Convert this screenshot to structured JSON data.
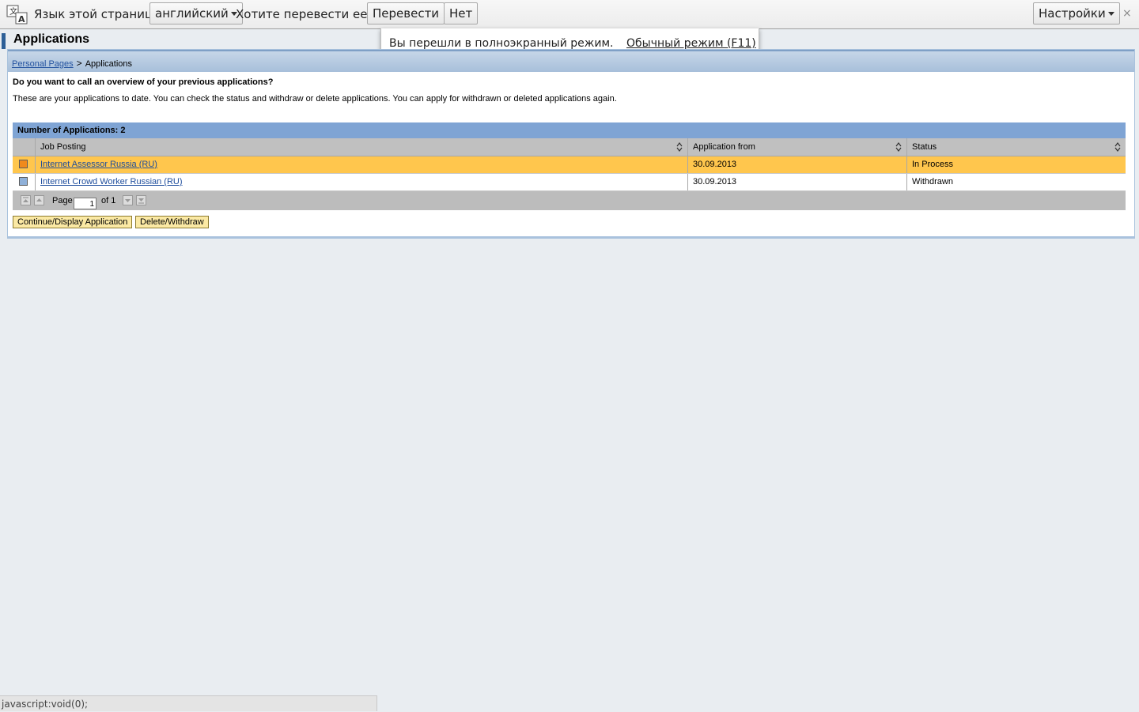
{
  "translate_bar": {
    "language_prompt": "Язык этой страницы",
    "language_value": "английский",
    "question": "Хотите перевести ее?",
    "translate_button": "Перевести",
    "no_button": "Нет",
    "settings_button": "Настройки",
    "close_glyph": "×"
  },
  "fullscreen_notice": {
    "message": "Вы перешли в полноэкранный режим.",
    "exit_link": "Обычный режим (F11)"
  },
  "page": {
    "title": "Applications",
    "breadcrumb": {
      "parent": "Personal Pages",
      "separator": ">",
      "current": "Applications"
    },
    "question": "Do you want to call an overview of your previous applications?",
    "description": "These are your applications to date. You can check the status and withdraw or delete applications. You can apply for withdrawn or deleted applications again."
  },
  "table": {
    "caption": "Number of Applications: 2",
    "columns": [
      "Job Posting",
      "Application from",
      "Status"
    ],
    "rows": [
      {
        "job": "Internet Assessor Russia (RU)",
        "date": "30.09.2013",
        "status": "In Process",
        "selected": true,
        "marker_color": "#f08a1c"
      },
      {
        "job": "Internet Crowd Worker Russian (RU)",
        "date": "30.09.2013",
        "status": "Withdrawn",
        "selected": false,
        "marker_color": "#8fb0d8"
      }
    ],
    "pager": {
      "page_label": "Page",
      "page_value": "1",
      "of_label": "of 1"
    }
  },
  "actions": {
    "continue_button": "Continue/Display Application",
    "delete_button": "Delete/Withdraw"
  },
  "status_bar": {
    "text": "javascript:void(0);"
  },
  "colors": {
    "selected_row": "#ffc64d",
    "table_caption_bg": "#7fa4d4",
    "accent": "#2d5f97",
    "action_button_bg": "#fbe9a4"
  }
}
